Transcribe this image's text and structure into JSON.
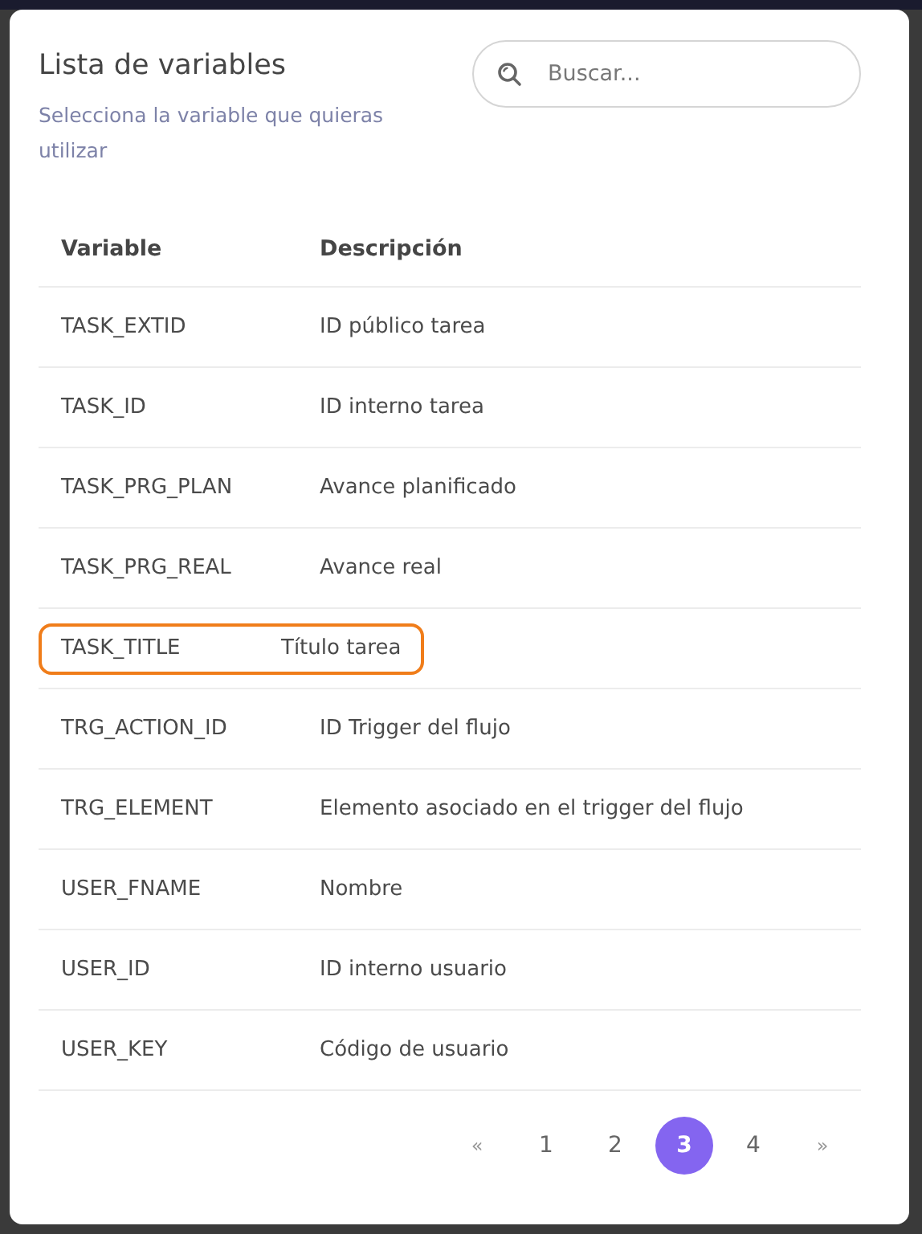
{
  "dialog": {
    "title": "Lista de variables",
    "subtitle": "Selecciona la variable que quieras utilizar"
  },
  "search": {
    "placeholder": "Buscar..."
  },
  "table": {
    "columns": [
      "Variable",
      "Descripción"
    ],
    "rows": [
      {
        "variable": "TASK_EXTID",
        "description": "ID público tarea",
        "highlighted": false
      },
      {
        "variable": "TASK_ID",
        "description": "ID interno tarea",
        "highlighted": false
      },
      {
        "variable": "TASK_PRG_PLAN",
        "description": "Avance planificado",
        "highlighted": false
      },
      {
        "variable": "TASK_PRG_REAL",
        "description": "Avance real",
        "highlighted": false
      },
      {
        "variable": "TASK_TITLE",
        "description": "Título tarea",
        "highlighted": true
      },
      {
        "variable": "TRG_ACTION_ID",
        "description": "ID Trigger del flujo",
        "highlighted": false
      },
      {
        "variable": "TRG_ELEMENT",
        "description": "Elemento asociado en el trigger del flujo",
        "highlighted": false
      },
      {
        "variable": "USER_FNAME",
        "description": "Nombre",
        "highlighted": false
      },
      {
        "variable": "USER_ID",
        "description": "ID interno usuario",
        "highlighted": false
      },
      {
        "variable": "USER_KEY",
        "description": "Código de usuario",
        "highlighted": false
      }
    ]
  },
  "pagination": [
    {
      "label": "«",
      "kind": "nav",
      "selected": false
    },
    {
      "label": "1",
      "kind": "page",
      "selected": false
    },
    {
      "label": "2",
      "kind": "page",
      "selected": false
    },
    {
      "label": "3",
      "kind": "page",
      "selected": true
    },
    {
      "label": "4",
      "kind": "page",
      "selected": false
    },
    {
      "label": "»",
      "kind": "nav",
      "selected": false
    }
  ]
}
